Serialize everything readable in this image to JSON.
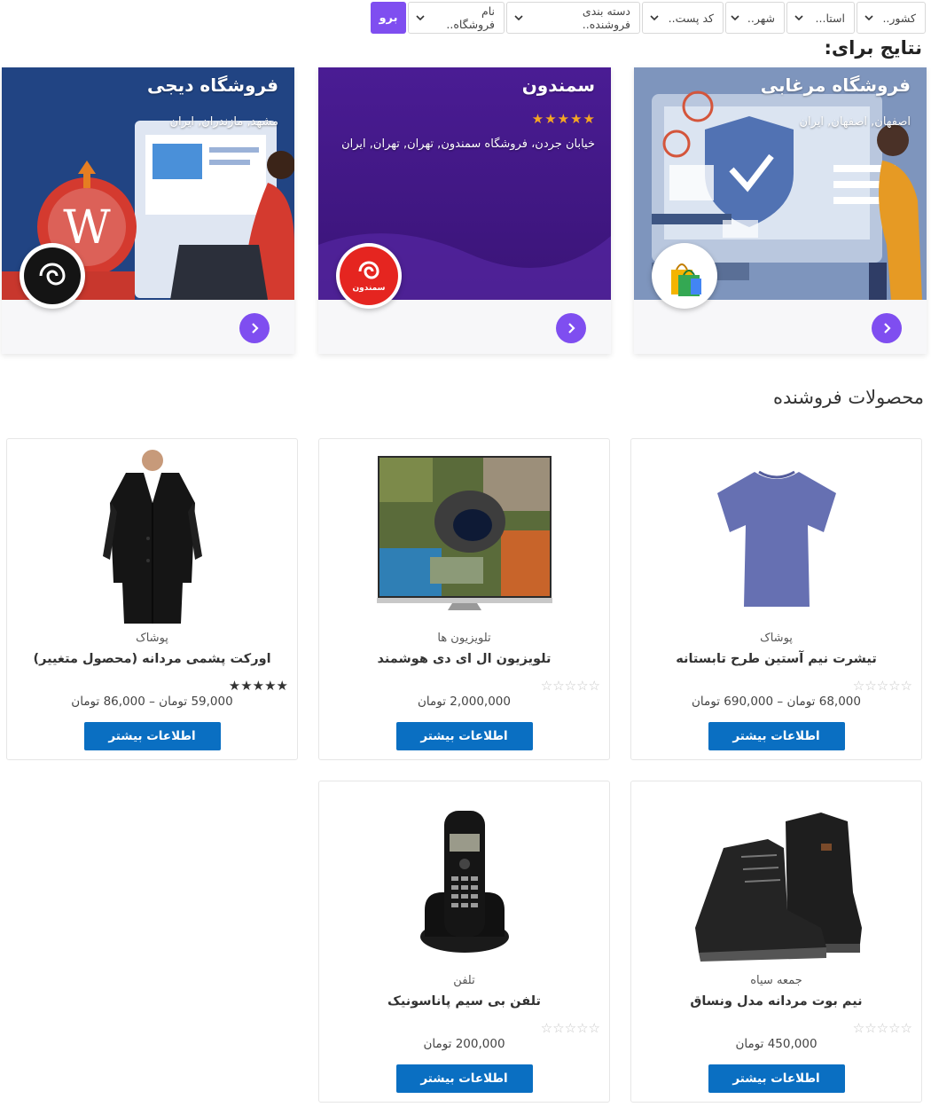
{
  "filters": {
    "country": "کشور..",
    "state": "استا...",
    "city": "شهر..",
    "postcode": "کد پست..",
    "vendor_category": "دسته بندی فروشنده..",
    "store_name": "نام فروشگاه..",
    "go_label": "برو"
  },
  "results_title": "نتایج برای:",
  "stores": [
    {
      "name": "فروشگاه مرغابی",
      "address": "اصفهان, اصفهان, ایران",
      "rating": 0
    },
    {
      "name": "سمندون",
      "address": "خیابان جردن، فروشگاه سمندون, تهران, تهران, ایران",
      "rating": 5
    },
    {
      "name": "فروشگاه دیجی",
      "address": "مشهد, مازندران, ایران",
      "rating": 0
    }
  ],
  "store_logo_text": {
    "samandoon": "سمندون"
  },
  "products_title": "محصولات فروشنده",
  "more_label": "اطلاعات بیشتر",
  "products": [
    {
      "category": "پوشاک",
      "title": "تیشرت نیم آستین طرح تابستانه",
      "price": "68,000 تومان – 690,000 تومان",
      "rating": 0
    },
    {
      "category": "تلویزیون ها",
      "title": "تلویزیون ال ای دی هوشمند",
      "price": "2,000,000 تومان",
      "rating": 0
    },
    {
      "category": "پوشاک",
      "title": "اورکت پشمی مردانه (محصول متغییر)",
      "price": "59,000 تومان – 86,000 تومان",
      "rating": 5
    },
    {
      "category": "جمعه سیاه",
      "title": "نیم بوت مردانه مدل ونساق",
      "price": "450,000 تومان",
      "rating": 0
    },
    {
      "category": "تلفن",
      "title": "تلفن بی سیم پاناسونیک",
      "price": "200,000 تومان",
      "rating": 0
    }
  ],
  "colors": {
    "accent": "#7f4ef0",
    "button_blue": "#0a6fc2"
  },
  "icons": {
    "dropdown": "chevron-down-icon",
    "store_link": "chevron-right-icon",
    "rating": "star-icon"
  }
}
